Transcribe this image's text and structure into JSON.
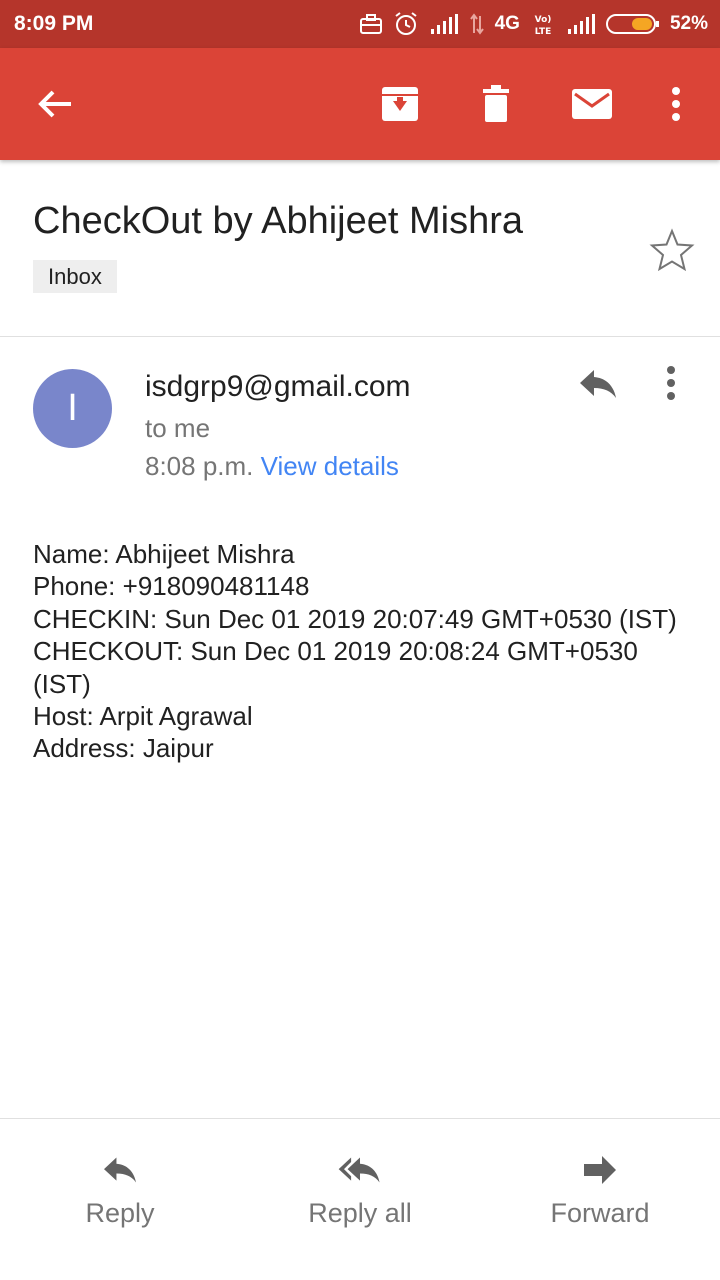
{
  "status": {
    "time": "8:09 PM",
    "network": "4G",
    "battery": "52%"
  },
  "colors": {
    "toolbar": "#db4437",
    "statusbar": "#b5352b",
    "avatar": "#7986cb",
    "link": "#4285f4"
  },
  "toolbar": {
    "icons": [
      "back-arrow-icon",
      "archive-icon",
      "delete-icon",
      "mark-unread-icon",
      "more-vert-icon"
    ]
  },
  "message": {
    "subject": "CheckOut by Abhijeet Mishra",
    "label": "Inbox",
    "avatar_letter": "I",
    "sender": "isdgrp9@gmail.com",
    "recipient": "to me",
    "time": "8:08 p.m.",
    "view_details": "View details",
    "body": [
      "Name: Abhijeet Mishra",
      "Phone: +918090481148",
      "CHECKIN: Sun Dec 01 2019 20:07:49 GMT+0530 (IST)",
      "CHECKOUT: Sun Dec 01 2019 20:08:24 GMT+0530 (IST)",
      "Host: Arpit Agrawal",
      "Address: Jaipur"
    ]
  },
  "actions": {
    "reply": "Reply",
    "reply_all": "Reply all",
    "forward": "Forward"
  }
}
